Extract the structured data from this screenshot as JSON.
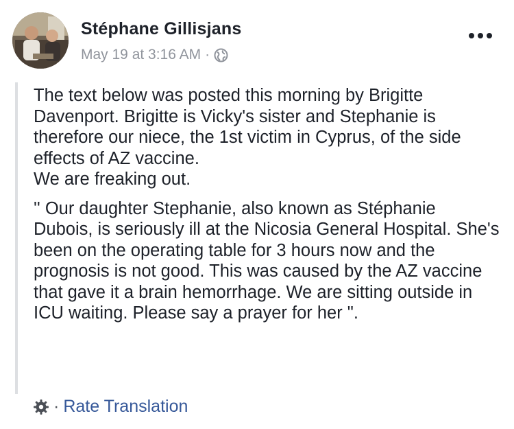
{
  "post": {
    "author": "Stéphane Gillisjans",
    "timestamp": "May 19 at 3:16 AM",
    "separator": "·",
    "privacy_icon": "globe-icon",
    "menu_icon": "more-options-icon",
    "paragraphs": [
      "The text below was posted this morning by Brigitte Davenport. Brigitte is Vicky's sister and Stephanie is therefore our niece, the 1st victim in Cyprus, of the side effects of AZ vaccine.\nWe are freaking out.",
      "'' Our daughter Stephanie, also known as Stéphanie Dubois, is seriously ill at the Nicosia General Hospital. She's been on the operating table for 3 hours now and the prognosis is not good. This was caused by the AZ vaccine that gave it a brain hemorrhage. We are sitting outside in ICU waiting. Please say a prayer for her \"."
    ]
  },
  "footer": {
    "settings_icon": "gear-icon",
    "separator": "·",
    "rate_translation": "Rate Translation"
  },
  "colors": {
    "text": "#1d2129",
    "meta": "#90949c",
    "link": "#365899",
    "quote_bar": "#dddfe2"
  }
}
